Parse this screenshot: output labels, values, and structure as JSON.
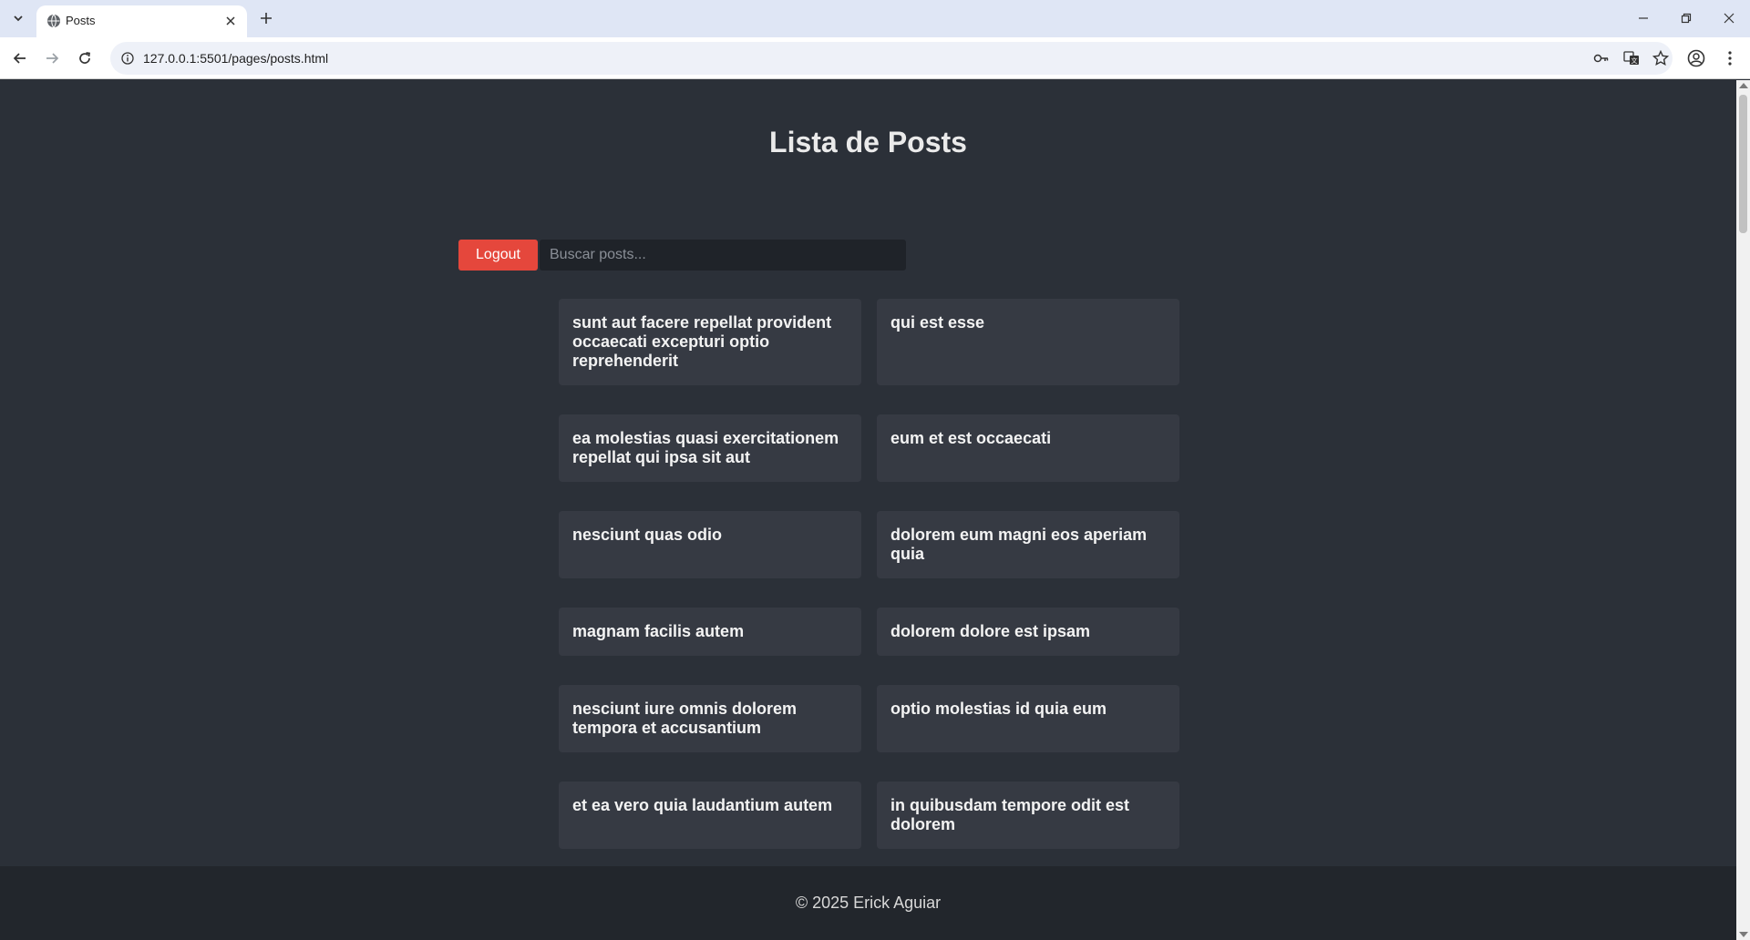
{
  "browser": {
    "tab": {
      "title": "Posts"
    },
    "url": "127.0.0.1:5501/pages/posts.html"
  },
  "page": {
    "title": "Lista de Posts",
    "logout_label": "Logout",
    "search_placeholder": "Buscar posts...",
    "posts": [
      "sunt aut facere repellat provident occaecati excepturi optio reprehenderit",
      "qui est esse",
      "ea molestias quasi exercitationem repellat qui ipsa sit aut",
      "eum et est occaecati",
      "nesciunt quas odio",
      "dolorem eum magni eos aperiam quia",
      "magnam facilis autem",
      "dolorem dolore est ipsam",
      "nesciunt iure omnis dolorem tempora et accusantium",
      "optio molestias id quia eum",
      "et ea vero quia laudantium autem",
      "in quibusdam tempore odit est dolorem"
    ],
    "footer": "© 2025 Erick Aguiar"
  },
  "colors": {
    "background": "#2b3038",
    "card": "#363a43",
    "logout": "#e5473c",
    "footer": "#22262c"
  }
}
